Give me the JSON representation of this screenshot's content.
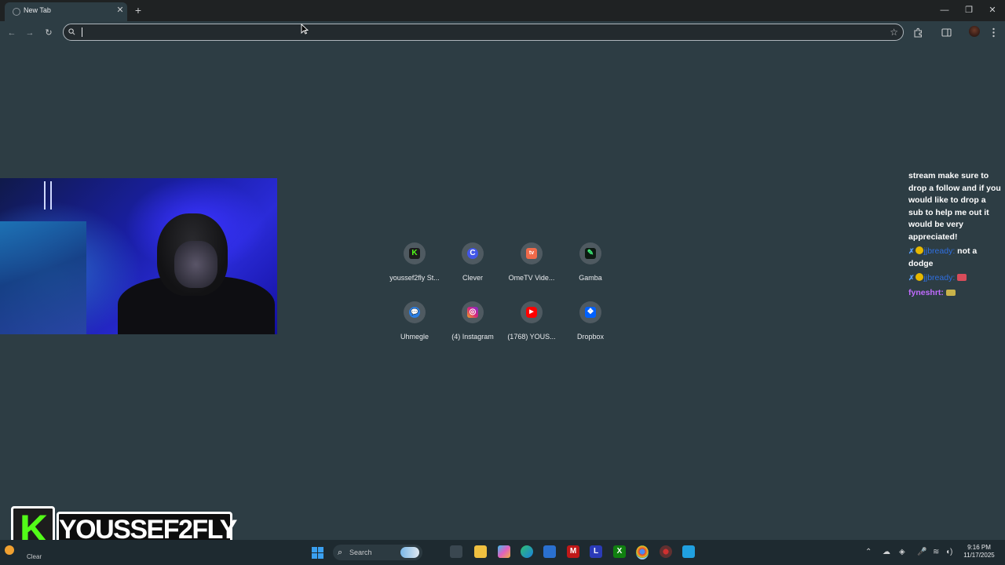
{
  "browser": {
    "tab": {
      "title": "New Tab",
      "close_glyph": "✕"
    },
    "new_tab_glyph": "+",
    "window_controls": {
      "minimize": "—",
      "maximize": "❐",
      "close": "✕"
    },
    "nav": {
      "back": "←",
      "forward": "→",
      "reload": "↻"
    },
    "omnibox": {
      "value": "",
      "placeholder": ""
    },
    "toolbar_icons": [
      "bookmark-star-icon",
      "extensions-icon",
      "side-panel-icon",
      "profile-avatar",
      "menu-icon"
    ]
  },
  "shortcuts": [
    {
      "label": "youssef2fly St...",
      "icon": "kick-icon",
      "glyph": "K",
      "color": "#1c1c1c",
      "glyph_color": "#53fc18"
    },
    {
      "label": "Clever",
      "icon": "clever-icon",
      "glyph": "C",
      "color": "#4256e8",
      "glyph_color": "#ffffff"
    },
    {
      "label": "OmeTV Vide...",
      "icon": "ometv-icon",
      "glyph": "tv",
      "color": "#f06a4a",
      "glyph_color": "#ffffff"
    },
    {
      "label": "Gamba",
      "icon": "gamba-icon",
      "glyph": "✎",
      "color": "#0d1a12",
      "glyph_color": "#3ef07a"
    },
    {
      "label": "Uhmegle",
      "icon": "uhmegle-icon",
      "glyph": "💬",
      "color": "#2a7de1",
      "glyph_color": "#ffffff"
    },
    {
      "label": "(4) Instagram",
      "icon": "instagram-icon",
      "glyph": "◎",
      "color": "#d6247a",
      "glyph_color": "#ffffff"
    },
    {
      "label": "(1768) YOUS...",
      "icon": "youtube-icon",
      "glyph": "▶",
      "color": "#ff0000",
      "glyph_color": "#ffffff"
    },
    {
      "label": "Dropbox",
      "icon": "dropbox-icon",
      "glyph": "❖",
      "color": "#0061fe",
      "glyph_color": "#ffffff"
    }
  ],
  "chat": {
    "message1": "stream make sure to drop a follow and if you would like to drop a sub to help me out it would be very appreciated!",
    "message2_user": "jjbready:",
    "message2_text": "not a dodge",
    "message3_user": "jjbready:",
    "message4_user": "fyneshrt:"
  },
  "brand": {
    "logo_letter": "K",
    "name": "YOUSSEF2FLY",
    "logo_color": "#53fc18"
  },
  "taskbar": {
    "weather_label": "Clear",
    "search_placeholder": "Search",
    "clock_time": "9:16 PM",
    "clock_date": "11/17/2025",
    "apps": [
      "start-icon",
      "task-view-icon",
      "file-explorer-icon",
      "copilot-icon",
      "edge-icon",
      "store-icon",
      "mcafee-icon",
      "launcher-icon",
      "xbox-icon",
      "chrome-icon",
      "chrome-alt-icon",
      "app-icon"
    ]
  }
}
